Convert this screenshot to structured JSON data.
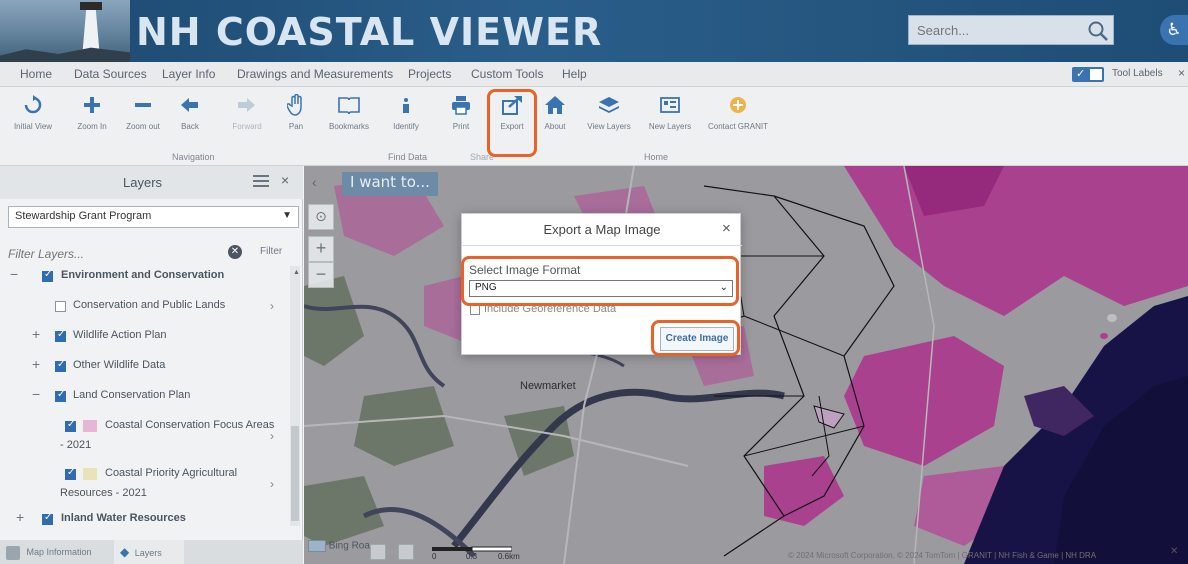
{
  "header": {
    "title": "NH COASTAL VIEWER",
    "search_placeholder": "Search...",
    "search_icon": "search-icon",
    "accessibility_icon": "accessibility-icon"
  },
  "menu": {
    "items": [
      "Home",
      "Data Sources",
      "Layer Info",
      "Drawings and Measurements",
      "Projects",
      "Custom Tools",
      "Help"
    ],
    "tool_labels": "Tool Labels",
    "close": "×"
  },
  "toolbar": {
    "tools": [
      {
        "label": "Initial View",
        "icon": "initial-view-icon"
      },
      {
        "label": "Zoom In",
        "icon": "zoom-in-icon"
      },
      {
        "label": "Zoom out",
        "icon": "zoom-out-icon"
      },
      {
        "label": "Back",
        "icon": "back-icon"
      },
      {
        "label": "Forward",
        "icon": "forward-icon"
      },
      {
        "label": "Pan",
        "icon": "pan-icon"
      },
      {
        "label": "Bookmarks",
        "icon": "bookmark-icon"
      },
      {
        "label": "Identify",
        "icon": "identify-icon"
      },
      {
        "label": "Print",
        "icon": "print-icon"
      },
      {
        "label": "Export",
        "icon": "export-icon"
      },
      {
        "label": "About",
        "icon": "home-icon"
      },
      {
        "label": "View Layers",
        "icon": "layers-icon"
      },
      {
        "label": "New Layers",
        "icon": "new-layers-icon"
      },
      {
        "label": "Contact GRANIT",
        "icon": "contact-icon"
      }
    ],
    "groups": {
      "navigation": "Navigation",
      "find_data": "Find Data",
      "share": "Share",
      "home": "Home"
    }
  },
  "layers_panel": {
    "title": "Layers",
    "close": "×",
    "selected_map": "Stewardship Grant Program",
    "filter_placeholder": "Filter Layers...",
    "filter_button": "Filter",
    "tree": [
      {
        "label": "Environment and Conservation",
        "checked": true,
        "expand": "−",
        "bold": true
      },
      {
        "label": "Conservation and Public Lands",
        "checked": false,
        "expand": ""
      },
      {
        "label": "Wildlife Action Plan",
        "checked": true,
        "expand": "+"
      },
      {
        "label": "Other Wildlife Data",
        "checked": true,
        "expand": "+"
      },
      {
        "label": "Land Conservation Plan",
        "checked": true,
        "expand": "−"
      },
      {
        "label": "Coastal Conservation Focus Areas",
        "label2": "- 2021",
        "checked": true,
        "expand": ""
      },
      {
        "label": "Coastal Priority Agricultural",
        "label2": "Resources - 2021",
        "checked": true,
        "expand": ""
      },
      {
        "label": "Inland Water Resources",
        "checked": true,
        "expand": "+",
        "bold": true
      }
    ],
    "tabs": [
      "Map Information",
      "Layers"
    ]
  },
  "map": {
    "i_want_to": "I want to...",
    "town_label": "Newmarket",
    "basemap_label": "Bing Roa...",
    "scale": [
      "0",
      "0.3",
      "0.6km"
    ],
    "copyright": "© 2024 Microsoft Corporation, © 2024 TomTom | GRANIT | NH Fish & Game | NH DRA"
  },
  "modal": {
    "title": "Export a Map Image",
    "close": "×",
    "format_label": "Select Image Format",
    "format_value": "PNG",
    "georef_label": "Include Georeference Data",
    "create_button": "Create Image"
  },
  "colors": {
    "header_blue": "#2a5e8a",
    "accent_orange": "#e8622a",
    "map_magenta": "#c62c9c",
    "map_navy": "#17124e"
  }
}
